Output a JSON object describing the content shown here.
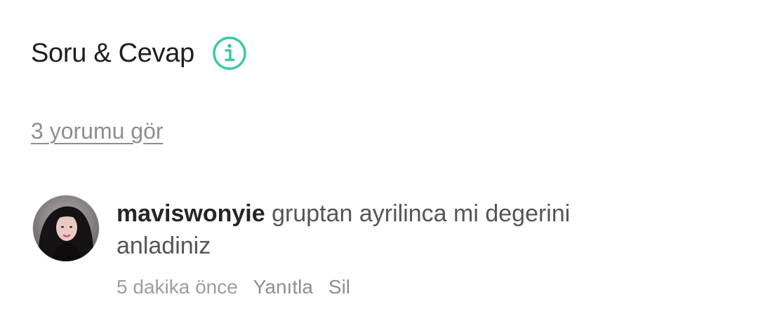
{
  "header": {
    "title": "Soru & Cevap",
    "info_icon": "info-circle-icon",
    "accent_color": "#3CC9A1"
  },
  "comments_link": {
    "label": "3 yorumu gör"
  },
  "comment": {
    "username": "maviswonyie",
    "text": "gruptan ayrilinca mi degerini anladiniz",
    "time": "5 dakika önce",
    "reply_label": "Yanıtla",
    "delete_label": "Sil",
    "avatar": "user-avatar-photo"
  }
}
